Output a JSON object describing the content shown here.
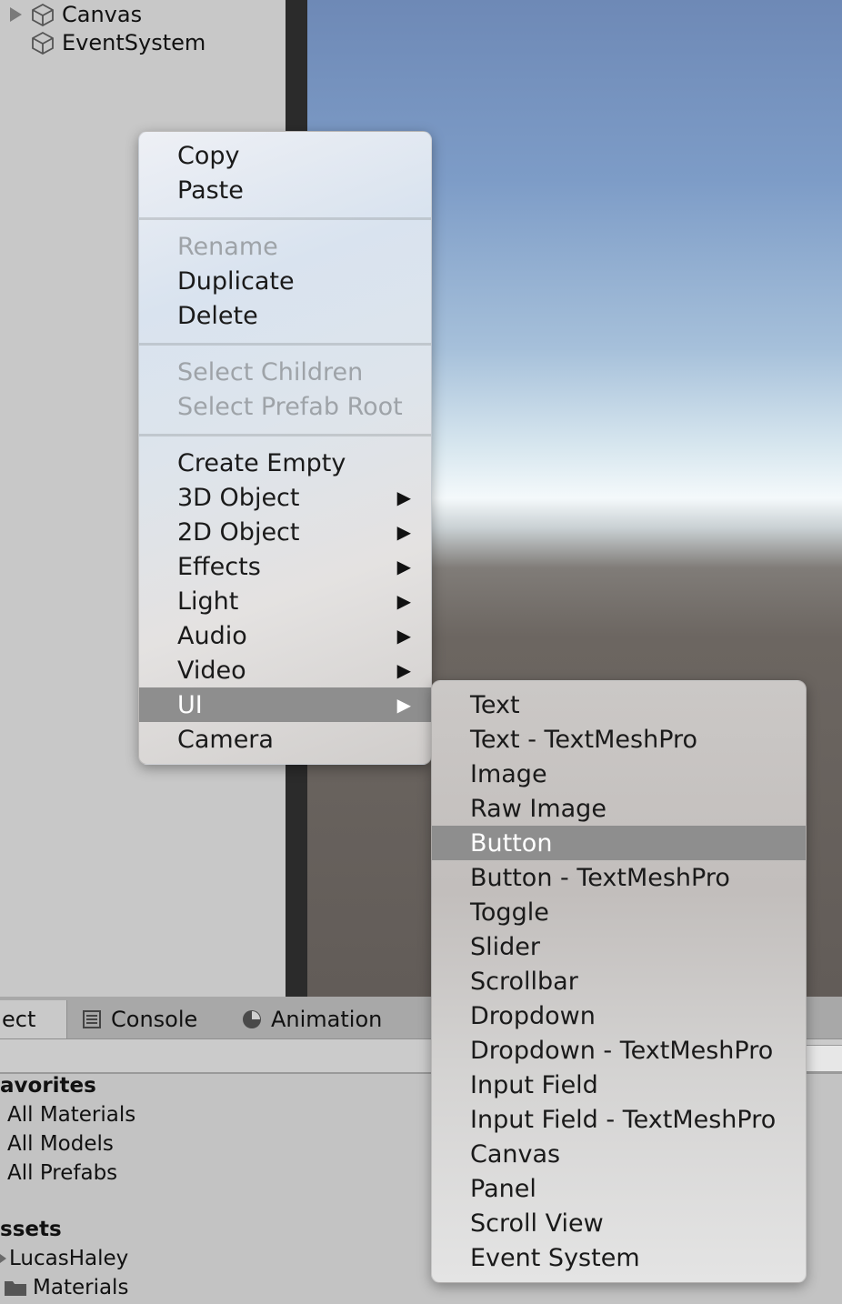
{
  "hierarchy": {
    "items": [
      {
        "label": "Canvas"
      },
      {
        "label": "EventSystem"
      }
    ]
  },
  "bottom_panel": {
    "tabs": [
      {
        "label": "ect"
      },
      {
        "label": "Console"
      },
      {
        "label": "Animation"
      }
    ],
    "favorites": {
      "title": "avorites",
      "items": [
        "All Materials",
        "All Models",
        "All Prefabs"
      ]
    },
    "assets": {
      "title": "ssets",
      "items": [
        "LucasHaley",
        "Materials"
      ]
    }
  },
  "context_menu": {
    "groups": [
      [
        {
          "label": "Copy"
        },
        {
          "label": "Paste"
        }
      ],
      [
        {
          "label": "Rename",
          "disabled": true
        },
        {
          "label": "Duplicate"
        },
        {
          "label": "Delete"
        }
      ],
      [
        {
          "label": "Select Children",
          "disabled": true
        },
        {
          "label": "Select Prefab Root",
          "disabled": true
        }
      ],
      [
        {
          "label": "Create Empty"
        },
        {
          "label": "3D Object",
          "submenu": true
        },
        {
          "label": "2D Object",
          "submenu": true
        },
        {
          "label": "Effects",
          "submenu": true
        },
        {
          "label": "Light",
          "submenu": true
        },
        {
          "label": "Audio",
          "submenu": true
        },
        {
          "label": "Video",
          "submenu": true
        },
        {
          "label": "UI",
          "submenu": true,
          "selected": true
        },
        {
          "label": "Camera"
        }
      ]
    ],
    "submenu_arrow": "▶"
  },
  "ui_submenu": {
    "items": [
      {
        "label": "Text"
      },
      {
        "label": "Text - TextMeshPro"
      },
      {
        "label": "Image"
      },
      {
        "label": "Raw Image"
      },
      {
        "label": "Button",
        "selected": true
      },
      {
        "label": "Button - TextMeshPro"
      },
      {
        "label": "Toggle"
      },
      {
        "label": "Slider"
      },
      {
        "label": "Scrollbar"
      },
      {
        "label": "Dropdown"
      },
      {
        "label": "Dropdown - TextMeshPro"
      },
      {
        "label": "Input Field"
      },
      {
        "label": "Input Field - TextMeshPro"
      },
      {
        "label": "Canvas"
      },
      {
        "label": "Panel"
      },
      {
        "label": "Scroll View"
      },
      {
        "label": "Event System"
      }
    ]
  },
  "colors": {
    "menu_selection": "#8e8e8e",
    "disabled_text": "#9ea3a8",
    "scene_sky": "#7d9cc7",
    "scene_ground": "#655f5b"
  },
  "icons": {
    "fold": "fold-arrow-icon",
    "gameobject": "cube-icon",
    "console": "console-icon",
    "animation": "animation-clock-icon",
    "folder": "folder-icon"
  }
}
